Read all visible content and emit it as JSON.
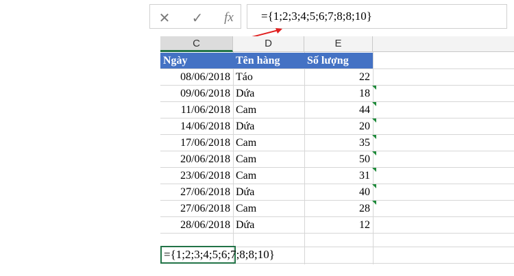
{
  "formula_bar": {
    "cancel_icon": "✕",
    "enter_icon": "✓",
    "fx_label": "fx",
    "formula": "={1;2;3;4;5;6;7;8;8;10}"
  },
  "columns": [
    "C",
    "D",
    "E"
  ],
  "header": {
    "date": "Ngày",
    "item": "Tên hàng",
    "qty": "Số lượng"
  },
  "rows": [
    {
      "date": "08/06/2018",
      "item": "Táo",
      "qty": "22"
    },
    {
      "date": "09/06/2018",
      "item": "Dứa",
      "qty": "18"
    },
    {
      "date": "11/06/2018",
      "item": "Cam",
      "qty": "44"
    },
    {
      "date": "14/06/2018",
      "item": "Dứa",
      "qty": "20"
    },
    {
      "date": "17/06/2018",
      "item": "Cam",
      "qty": "35"
    },
    {
      "date": "20/06/2018",
      "item": "Cam",
      "qty": "50"
    },
    {
      "date": "23/06/2018",
      "item": "Cam",
      "qty": "31"
    },
    {
      "date": "27/06/2018",
      "item": "Dứa",
      "qty": "40"
    },
    {
      "date": "27/06/2018",
      "item": "Cam",
      "qty": "28"
    },
    {
      "date": "28/06/2018",
      "item": "Dứa",
      "qty": "12"
    }
  ],
  "active_cell_content": "={1;2;3;4;5;6;7;8;8;10}",
  "colors": {
    "header_fill": "#4472c4",
    "selection": "#217346",
    "arrow": "#e02020",
    "error_marker": "#1e8a3a"
  }
}
